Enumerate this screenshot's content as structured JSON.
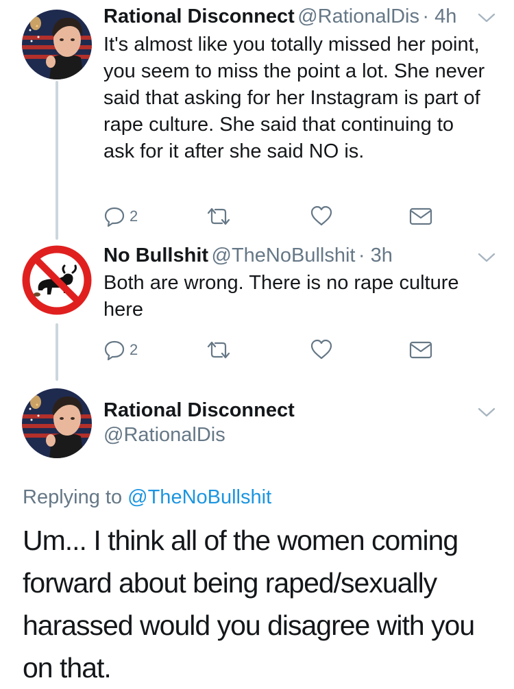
{
  "tweets": [
    {
      "name": "Rational Disconnect",
      "handle": "@RationalDis",
      "time": "· 4h",
      "text": "It's almost like you totally missed her point, you seem to miss the point a lot. She never said that asking for her Instagram is part of rape culture. She said that continuing to ask for it after she said NO is.",
      "reply_count": "2"
    },
    {
      "name": "No Bullshit",
      "handle": "@TheNoBullshit",
      "time": "· 3h",
      "text": "Both are wrong. There is no rape culture here",
      "reply_count": "2"
    }
  ],
  "focused": {
    "name": "Rational Disconnect",
    "handle": "@RationalDis",
    "replying_prefix": "Replying to",
    "replying_to": "@TheNoBullshit",
    "text": "Um... I think all of the women coming forward about being raped/sexually harassed would you disagree with you on that."
  },
  "icons": [
    "reply-icon",
    "retweet-icon",
    "like-icon",
    "dm-icon",
    "chevron-down-icon"
  ],
  "colors": {
    "link": "#1b95e0",
    "secondary": "#657786",
    "thread": "#ccd6dd",
    "no_sign_red": "#e0201f"
  }
}
